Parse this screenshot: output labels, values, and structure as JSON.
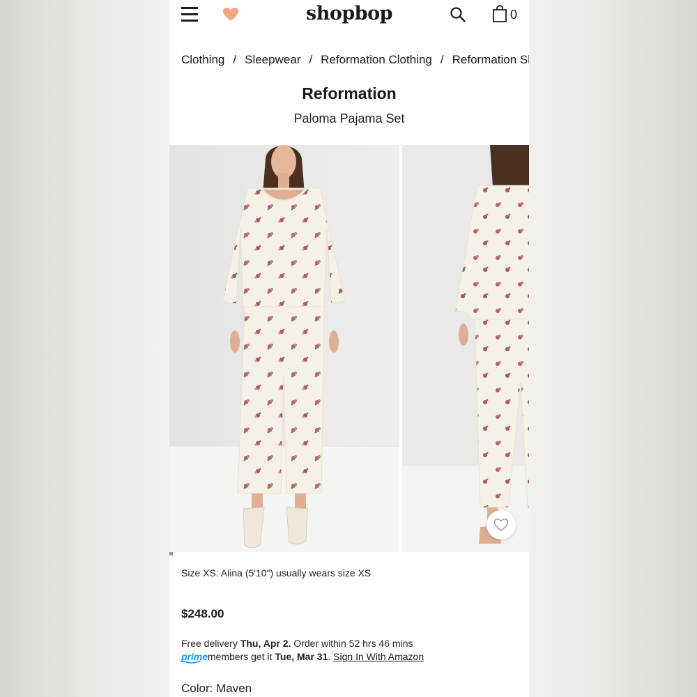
{
  "header": {
    "logo": "shopbop",
    "bag_count": "0",
    "icons": [
      "menu-icon",
      "heart-icon",
      "search-icon",
      "bag-icon"
    ],
    "heart_color": "#f4a582"
  },
  "breadcrumb": {
    "items": [
      "Clothing",
      "Sleepwear",
      "Reformation Clothing",
      "Reformation Sleepwear"
    ],
    "separator": "/"
  },
  "product": {
    "brand": "Reformation",
    "name": "Paloma Pajama Set",
    "size_note": "Size XS: Alina (5'10\") usually wears size XS",
    "price": "$248.00"
  },
  "delivery": {
    "prefix": "Free delivery ",
    "date": "Thu, Apr 2.",
    "suffix": " Order within 52 hrs 46 mins"
  },
  "prime": {
    "logo_text": "prime",
    "text": " members get it ",
    "date": "Tue, Mar 31",
    "period": ". ",
    "link": "Sign In With Amazon"
  },
  "color": {
    "label": "Color: ",
    "value": "Maven"
  }
}
